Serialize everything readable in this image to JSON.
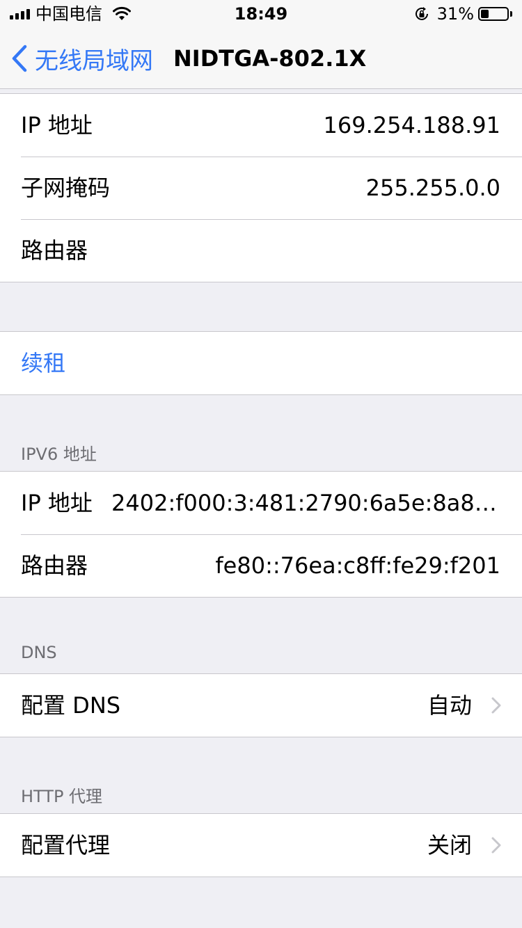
{
  "status_bar": {
    "carrier": "中国电信",
    "time": "18:49",
    "battery_percent": "31%",
    "battery_level": 0.31,
    "icons": [
      "signal-icon",
      "wifi-icon",
      "rotation-lock-icon",
      "battery-icon"
    ]
  },
  "nav": {
    "back_label": "无线局域网",
    "title": "NIDTGA-802.1X"
  },
  "ipv4": {
    "ip_label": "IP 地址",
    "ip_value": "169.254.188.91",
    "subnet_label": "子网掩码",
    "subnet_value": "255.255.0.0",
    "router_label": "路由器",
    "router_value": ""
  },
  "renew": {
    "label": "续租"
  },
  "ipv6": {
    "header": "IPV6 地址",
    "ip_label": "IP 地址",
    "ip_value": "2402:f000:3:481:2790:6a5e:8a83:...",
    "router_label": "路由器",
    "router_value": "fe80::76ea:c8ff:fe29:f201"
  },
  "dns": {
    "header": "DNS",
    "label": "配置 DNS",
    "value": "自动"
  },
  "proxy": {
    "header": "HTTP 代理",
    "label": "配置代理",
    "value": "关闭"
  },
  "colors": {
    "accent": "#3478f6",
    "background": "#efeff4",
    "separator": "#c8c7cc",
    "section_header": "#6d6d72"
  }
}
